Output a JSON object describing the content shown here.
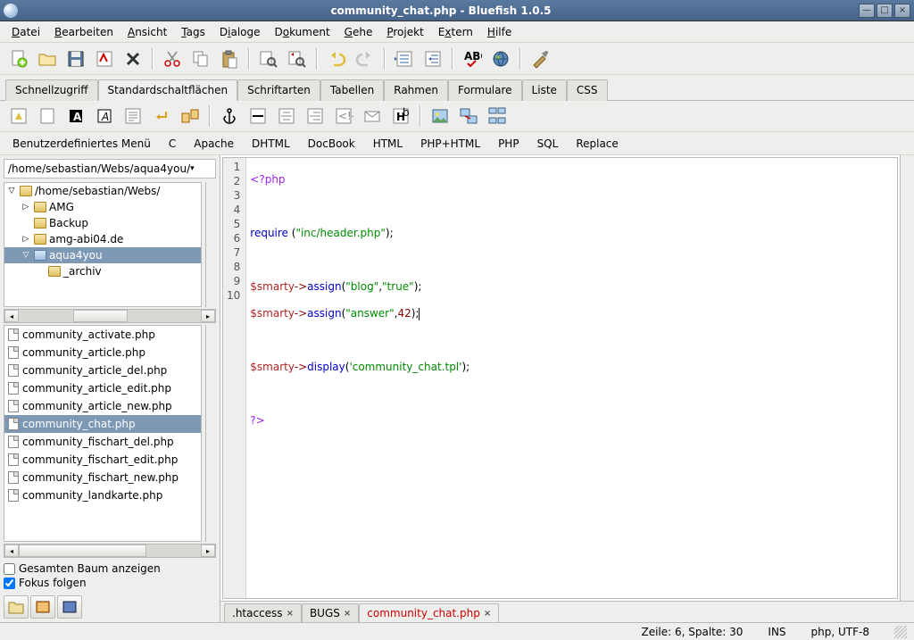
{
  "window": {
    "title": "community_chat.php - Bluefish 1.0.5"
  },
  "menubar": [
    "Datei",
    "Bearbeiten",
    "Ansicht",
    "Tags",
    "Dialoge",
    "Dokument",
    "Gehe",
    "Projekt",
    "Extern",
    "Hilfe"
  ],
  "notebook_tabs": [
    "Schnellzugriff",
    "Standardschaltflächen",
    "Schriftarten",
    "Tabellen",
    "Rahmen",
    "Formulare",
    "Liste",
    "CSS"
  ],
  "notebook_active": 1,
  "custom_menus": [
    "Benutzerdefiniertes Menü",
    "C",
    "Apache",
    "DHTML",
    "DocBook",
    "HTML",
    "PHP+HTML",
    "PHP",
    "SQL",
    "Replace"
  ],
  "path": "/home/sebastian/Webs/aqua4you/",
  "tree": [
    {
      "level": 0,
      "expander": "▽",
      "label": "/home/sebastian/Webs/",
      "open": true
    },
    {
      "level": 1,
      "expander": "▷",
      "label": "AMG"
    },
    {
      "level": 1,
      "expander": "",
      "label": "Backup"
    },
    {
      "level": 1,
      "expander": "▷",
      "label": "amg-abi04.de"
    },
    {
      "level": 1,
      "expander": "▽",
      "label": "aqua4you",
      "selected": true,
      "open": true
    },
    {
      "level": 2,
      "expander": "",
      "label": "_archiv"
    }
  ],
  "files": [
    "community_activate.php",
    "community_article.php",
    "community_article_del.php",
    "community_article_edit.php",
    "community_article_new.php",
    "community_chat.php",
    "community_fischart_del.php",
    "community_fischart_edit.php",
    "community_fischart_new.php",
    "community_landkarte.php"
  ],
  "file_selected": 5,
  "checks": {
    "gesamten": {
      "label": "Gesamten Baum anzeigen",
      "checked": false
    },
    "fokus": {
      "label": "Fokus folgen",
      "checked": true
    }
  },
  "code_lines": 10,
  "editor_tabs": [
    {
      "label": ".htaccess",
      "active": false,
      "modified": false
    },
    {
      "label": "BUGS",
      "active": false,
      "modified": false
    },
    {
      "label": "community_chat.php",
      "active": true,
      "modified": true
    }
  ],
  "statusbar": {
    "position": "Zeile: 6, Spalte: 30",
    "insert": "INS",
    "mode": "php, UTF-8"
  }
}
